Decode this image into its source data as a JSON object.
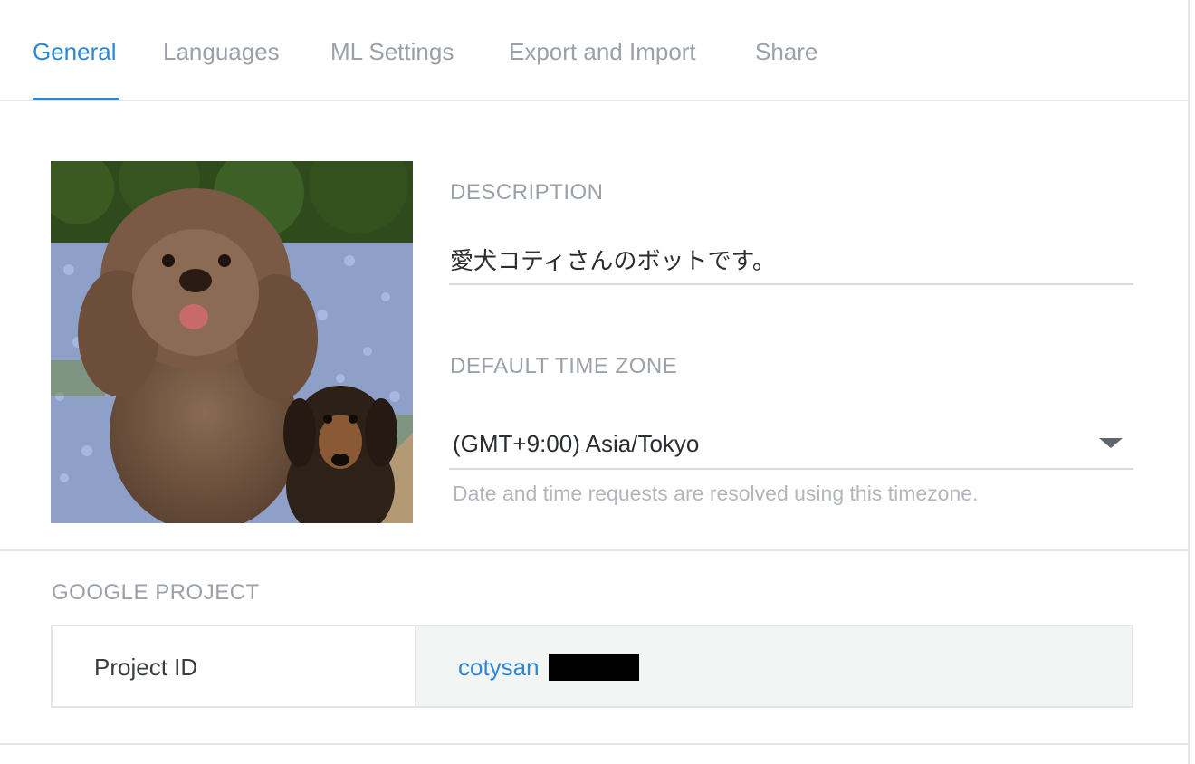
{
  "tabs": [
    {
      "label": "General",
      "active": true
    },
    {
      "label": "Languages",
      "active": false
    },
    {
      "label": "ML Settings",
      "active": false
    },
    {
      "label": "Export and Import",
      "active": false
    },
    {
      "label": "Share",
      "active": false
    }
  ],
  "general": {
    "description_label": "DESCRIPTION",
    "description_value": "愛犬コティさんのボットです。",
    "timezone_label": "DEFAULT TIME ZONE",
    "timezone_value": "(GMT+9:00) Asia/Tokyo",
    "timezone_hint": "Date and time requests are resolved using this timezone."
  },
  "google_project": {
    "section_label": "GOOGLE PROJECT",
    "key": "Project ID",
    "value": "cotysan"
  },
  "colors": {
    "accent": "#2e87d3",
    "muted_text": "#9aa1a9",
    "border": "#e4e6e9"
  }
}
